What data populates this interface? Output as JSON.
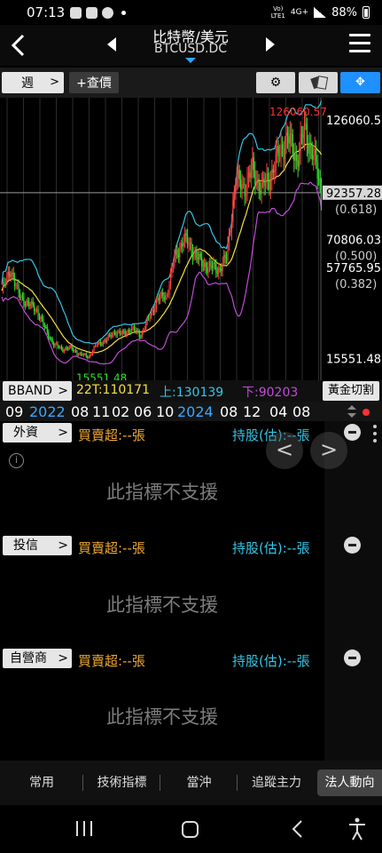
{
  "status_bar": {
    "time": "07:13",
    "network_top": "Vo)",
    "network_bottom": "LTE1",
    "network_type": "4G+",
    "battery": "88%"
  },
  "header": {
    "title": "比特幣/美元",
    "subtitle": "BTCUSD.DC"
  },
  "toolbar": {
    "period_label": "週",
    "quote_label": "+查價"
  },
  "chart_data": {
    "type": "candlestick",
    "period": "weekly",
    "y_ticks": [
      "126060.57",
      "92357.28",
      "70806.03",
      "57765.95",
      "15551.48"
    ],
    "fib_ticks": [
      "(0.618)",
      "(0.500)",
      "(0.382)"
    ],
    "current_price": "92357.28",
    "high_annotation": "126060.57",
    "low_annotation": "15551.48",
    "ylim": [
      8000,
      133000
    ],
    "x_ticks": [
      {
        "label": "09",
        "highlight": false
      },
      {
        "label": "2022",
        "highlight": true
      },
      {
        "label": "08",
        "highlight": false
      },
      {
        "label": "11",
        "highlight": false
      },
      {
        "label": "02",
        "highlight": false
      },
      {
        "label": "06",
        "highlight": false
      },
      {
        "label": "10",
        "highlight": false
      },
      {
        "label": "2024",
        "highlight": true
      },
      {
        "label": "08",
        "highlight": false
      },
      {
        "label": "12",
        "highlight": false
      },
      {
        "label": "04",
        "highlight": false
      },
      {
        "label": "08",
        "highlight": false
      }
    ],
    "keypoints": [
      [
        0,
        47000
      ],
      [
        7,
        57000
      ],
      [
        13,
        45000
      ],
      [
        20,
        41000
      ],
      [
        27,
        38000
      ],
      [
        33,
        30000
      ],
      [
        40,
        22000
      ],
      [
        47,
        20000
      ],
      [
        53,
        20500
      ],
      [
        60,
        17500
      ],
      [
        67,
        16500
      ],
      [
        73,
        22000
      ],
      [
        80,
        24000
      ],
      [
        87,
        28000
      ],
      [
        93,
        27000
      ],
      [
        100,
        29500
      ],
      [
        107,
        26500
      ],
      [
        113,
        34000
      ],
      [
        120,
        43000
      ],
      [
        127,
        45000
      ],
      [
        133,
        62000
      ],
      [
        140,
        71000
      ],
      [
        147,
        66000
      ],
      [
        153,
        60000
      ],
      [
        160,
        58000
      ],
      [
        167,
        57000
      ],
      [
        173,
        62000
      ],
      [
        180,
        98000
      ],
      [
        187,
        95000
      ],
      [
        193,
        103000
      ],
      [
        200,
        94000
      ],
      [
        207,
        100000
      ],
      [
        213,
        110000
      ],
      [
        220,
        118000
      ],
      [
        227,
        108000
      ],
      [
        233,
        121000
      ],
      [
        240,
        110000
      ],
      [
        246,
        91000
      ]
    ],
    "colors": {
      "up": "#ff4040",
      "down": "#30e030",
      "mid": "#f4e040",
      "upper": "#33c7e8",
      "lower": "#c04bd8",
      "high": "#ff3030",
      "low": "#30e030"
    }
  },
  "indicator": {
    "name": "BBAND",
    "mid": "22T:110171",
    "upper": "上:130139",
    "lower": "下:90203",
    "golden_cut": "黃金切割"
  },
  "sections": [
    {
      "name": "外資",
      "buysell": "買賣超:--張",
      "holding": "持股(估):--張",
      "message": "此指標不支援"
    },
    {
      "name": "投信",
      "buysell": "買賣超:--張",
      "holding": "持股(估):--張",
      "message": "此指標不支援"
    },
    {
      "name": "自營商",
      "buysell": "買賣超:--張",
      "holding": "持股(估):--張",
      "message": "此指標不支援"
    }
  ],
  "bottom_tabs": [
    {
      "label": "常用"
    },
    {
      "label": "技術指標"
    },
    {
      "label": "當沖"
    },
    {
      "label": "追蹤主力"
    },
    {
      "label": "法人動向"
    }
  ],
  "overlay": {
    "prev": "<",
    "next": ">"
  },
  "info_glyph": "i"
}
